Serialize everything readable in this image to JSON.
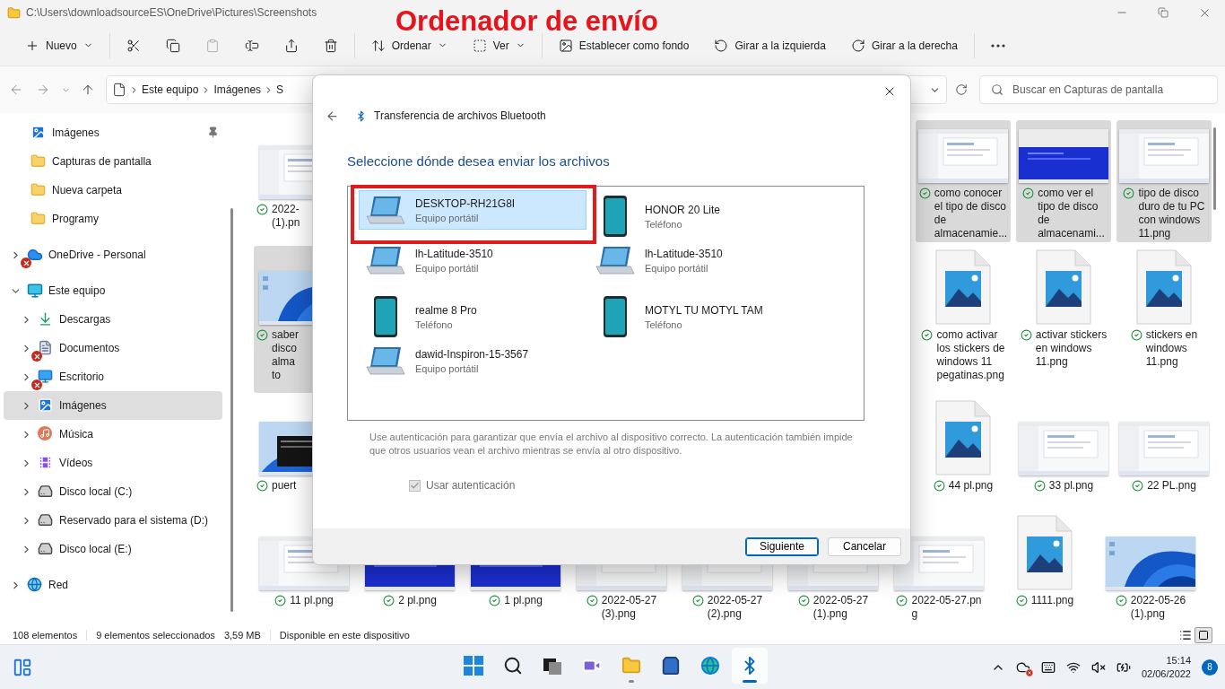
{
  "window": {
    "path": "C:\\Users\\downloadsourceES\\OneDrive\\Pictures\\Screenshots"
  },
  "annotation": {
    "title": "Ordenador de envío"
  },
  "command_bar": [
    [
      {
        "kind": "new",
        "label": "Nuevo",
        "disabled": false
      }
    ],
    [
      {
        "kind": "cut",
        "disabled": false
      },
      {
        "kind": "copy",
        "disabled": false
      },
      {
        "kind": "paste",
        "disabled": true
      },
      {
        "kind": "rename",
        "disabled": false
      },
      {
        "kind": "share",
        "disabled": false
      },
      {
        "kind": "delete",
        "disabled": false
      }
    ],
    [
      {
        "kind": "sort",
        "label": "Ordenar",
        "disabled": false
      },
      {
        "kind": "view",
        "label": "Ver",
        "disabled": false
      }
    ],
    [
      {
        "kind": "wallpaper",
        "label": "Establecer como fondo",
        "disabled": false
      },
      {
        "kind": "rotate_left",
        "label": "Girar a la izquierda",
        "disabled": false
      },
      {
        "kind": "rotate_right",
        "label": "Girar a la derecha",
        "disabled": false
      }
    ],
    [
      {
        "kind": "more",
        "disabled": false
      }
    ]
  ],
  "address": {
    "crumbs": [
      "Este equipo",
      "Imágenes",
      "S"
    ],
    "search_placeholder": "Buscar en Capturas de pantalla"
  },
  "sidebar": {
    "quick_access": [
      {
        "kind": "pictures",
        "label": "Imágenes",
        "pinned": true
      },
      {
        "kind": "folder",
        "label": "Capturas de pantalla",
        "pinned": false
      },
      {
        "kind": "folder",
        "label": "Nueva carpeta",
        "pinned": false
      },
      {
        "kind": "folder",
        "label": "Programy",
        "pinned": false
      }
    ],
    "tree": [
      {
        "kind": "onedrive",
        "label": "OneDrive - Personal",
        "expanded": false,
        "selected": false,
        "sync_error": true
      },
      {
        "kind": "pc",
        "label": "Este equipo",
        "expanded": true,
        "selected": false,
        "sync_error": false,
        "children": [
          {
            "kind": "download",
            "label": "Descargas",
            "expanded": false,
            "selected": false,
            "sync_error": false
          },
          {
            "kind": "documents",
            "label": "Documentos",
            "expanded": false,
            "selected": false,
            "sync_error": true
          },
          {
            "kind": "desktop",
            "label": "Escritorio",
            "expanded": false,
            "selected": false,
            "sync_error": true
          },
          {
            "kind": "pictures",
            "label": "Imágenes",
            "expanded": false,
            "selected": true,
            "sync_error": false
          },
          {
            "kind": "music",
            "label": "Música",
            "expanded": false,
            "selected": false,
            "sync_error": false
          },
          {
            "kind": "videos",
            "label": "Vídeos",
            "expanded": false,
            "selected": false,
            "sync_error": false
          },
          {
            "kind": "system_drive",
            "label": "Disco local (C:)",
            "expanded": false,
            "selected": false,
            "sync_error": false
          },
          {
            "kind": "drive",
            "label": "Reservado para el sistema (D:)",
            "expanded": false,
            "selected": false,
            "sync_error": false
          },
          {
            "kind": "drive",
            "label": "Disco local (E:)",
            "expanded": false,
            "selected": false,
            "sync_error": false
          }
        ]
      },
      {
        "kind": "network",
        "label": "Red",
        "expanded": false,
        "selected": false,
        "sync_error": false
      }
    ]
  },
  "files": {
    "rows": [
      {
        "left": {
          "kind": "screenshot",
          "caption": "2022-\n(1).pn",
          "selected": false
        },
        "right": [
          {
            "kind": "screenshot",
            "caption": "como conocer\nel tipo de disco\nde\nalmacenamie...",
            "selected": true
          },
          {
            "kind": "blue-screen",
            "caption": "como ver el\ntipo de disco\nde\nalmacenami...",
            "selected": true
          },
          {
            "kind": "screenshot",
            "caption": "tipo de disco\nduro de tu PC\ncon windows\n11.png",
            "selected": true
          }
        ]
      },
      {
        "left": {
          "kind": "desktop",
          "caption": "saber\ndisco\nalma\nto",
          "selected": true
        },
        "right": [
          {
            "kind": "file",
            "caption": "como activar\nlos stickers de\nwindows 11\npegatinas.png",
            "selected": false
          },
          {
            "kind": "file",
            "caption": "activar stickers\nen windows\n11.png",
            "selected": false
          },
          {
            "kind": "file",
            "caption": "stickers en\nwindows\n11.png",
            "selected": false
          }
        ]
      },
      {
        "left": {
          "kind": "console",
          "caption": "puert",
          "selected": false
        },
        "right": [
          {
            "kind": "file",
            "caption": "44 pl.png",
            "selected": false
          },
          {
            "kind": "screenshot",
            "caption": "33 pl.png",
            "selected": false
          },
          {
            "kind": "screenshot",
            "caption": "22 PL.png",
            "selected": false
          }
        ]
      }
    ],
    "last_row": [
      {
        "kind": "screenshot",
        "caption": "11 pl.png",
        "selected": false
      },
      {
        "kind": "blue-screen",
        "caption": "2 pl.png",
        "selected": false
      },
      {
        "kind": "blue-screen",
        "caption": "1 pl.png",
        "selected": false
      },
      {
        "kind": "screenshot",
        "caption": "2022-05-27\n(3).png",
        "selected": false
      },
      {
        "kind": "screenshot",
        "caption": "2022-05-27\n(2).png",
        "selected": false
      },
      {
        "kind": "screenshot",
        "caption": "2022-05-27\n(1).png",
        "selected": false
      },
      {
        "kind": "screenshot",
        "caption": "2022-05-27.pn\ng",
        "selected": false
      },
      {
        "kind": "file",
        "caption": "1111.png",
        "selected": false
      },
      {
        "kind": "desktop",
        "caption": "2022-05-26\n(1).png",
        "selected": false
      }
    ]
  },
  "dialog": {
    "title": "Transferencia de archivos Bluetooth",
    "heading": "Seleccione dónde desea enviar los archivos",
    "devices": [
      {
        "kind": "laptop",
        "name": "DESKTOP-RH21G8I",
        "type": "Equipo portátil",
        "selected": true,
        "marked": true
      },
      {
        "kind": "phone",
        "name": "HONOR 20 Lite",
        "type": "Teléfono",
        "selected": false,
        "marked": false
      },
      {
        "kind": "laptop",
        "name": "lh-Latitude-3510",
        "type": "Equipo portátil",
        "selected": false,
        "marked": false
      },
      {
        "kind": "laptop",
        "name": "lh-Latitude-3510",
        "type": "Equipo portátil",
        "selected": false,
        "marked": false
      },
      {
        "kind": "phone",
        "name": "realme 8 Pro",
        "type": "Teléfono",
        "selected": false,
        "marked": false
      },
      {
        "kind": "phone",
        "name": "MOTYL TU MOTYL TAM",
        "type": "Teléfono",
        "selected": false,
        "marked": false
      },
      {
        "kind": "laptop",
        "name": "dawid-Inspiron-15-3567",
        "type": "Equipo portátil",
        "selected": false,
        "marked": false
      }
    ],
    "note": "Use autenticación para garantizar que envía el archivo al dispositivo correcto. La autenticación también impide que otros usuarios vean el archivo mientras se envía al otro dispositivo.",
    "auth": {
      "label": "Usar autenticación",
      "checked": true,
      "disabled": true
    },
    "buttons": [
      {
        "label": "Siguiente",
        "primary": true
      },
      {
        "label": "Cancelar",
        "primary": false
      }
    ]
  },
  "status_bar": {
    "count": "108 elementos",
    "selection": "9 elementos seleccionados",
    "size": "3,59 MB",
    "availability": "Disponible en este dispositivo",
    "views": [
      {
        "kind": "details",
        "selected": false
      },
      {
        "kind": "tiles",
        "selected": true
      }
    ]
  },
  "taskbar": {
    "apps": [
      {
        "kind": "start",
        "running": false,
        "active": false
      },
      {
        "kind": "search",
        "running": false,
        "active": false
      },
      {
        "kind": "task_view",
        "running": false,
        "active": false
      },
      {
        "kind": "chat",
        "running": false,
        "active": false
      },
      {
        "kind": "explorer",
        "running": true,
        "active": false
      },
      {
        "kind": "store",
        "running": false,
        "active": false
      },
      {
        "kind": "edge",
        "running": false,
        "active": false
      },
      {
        "kind": "bluetooth",
        "running": true,
        "active": true
      }
    ],
    "tray": {
      "time": "15:14",
      "date": "02/06/2022",
      "badge": "8"
    }
  }
}
